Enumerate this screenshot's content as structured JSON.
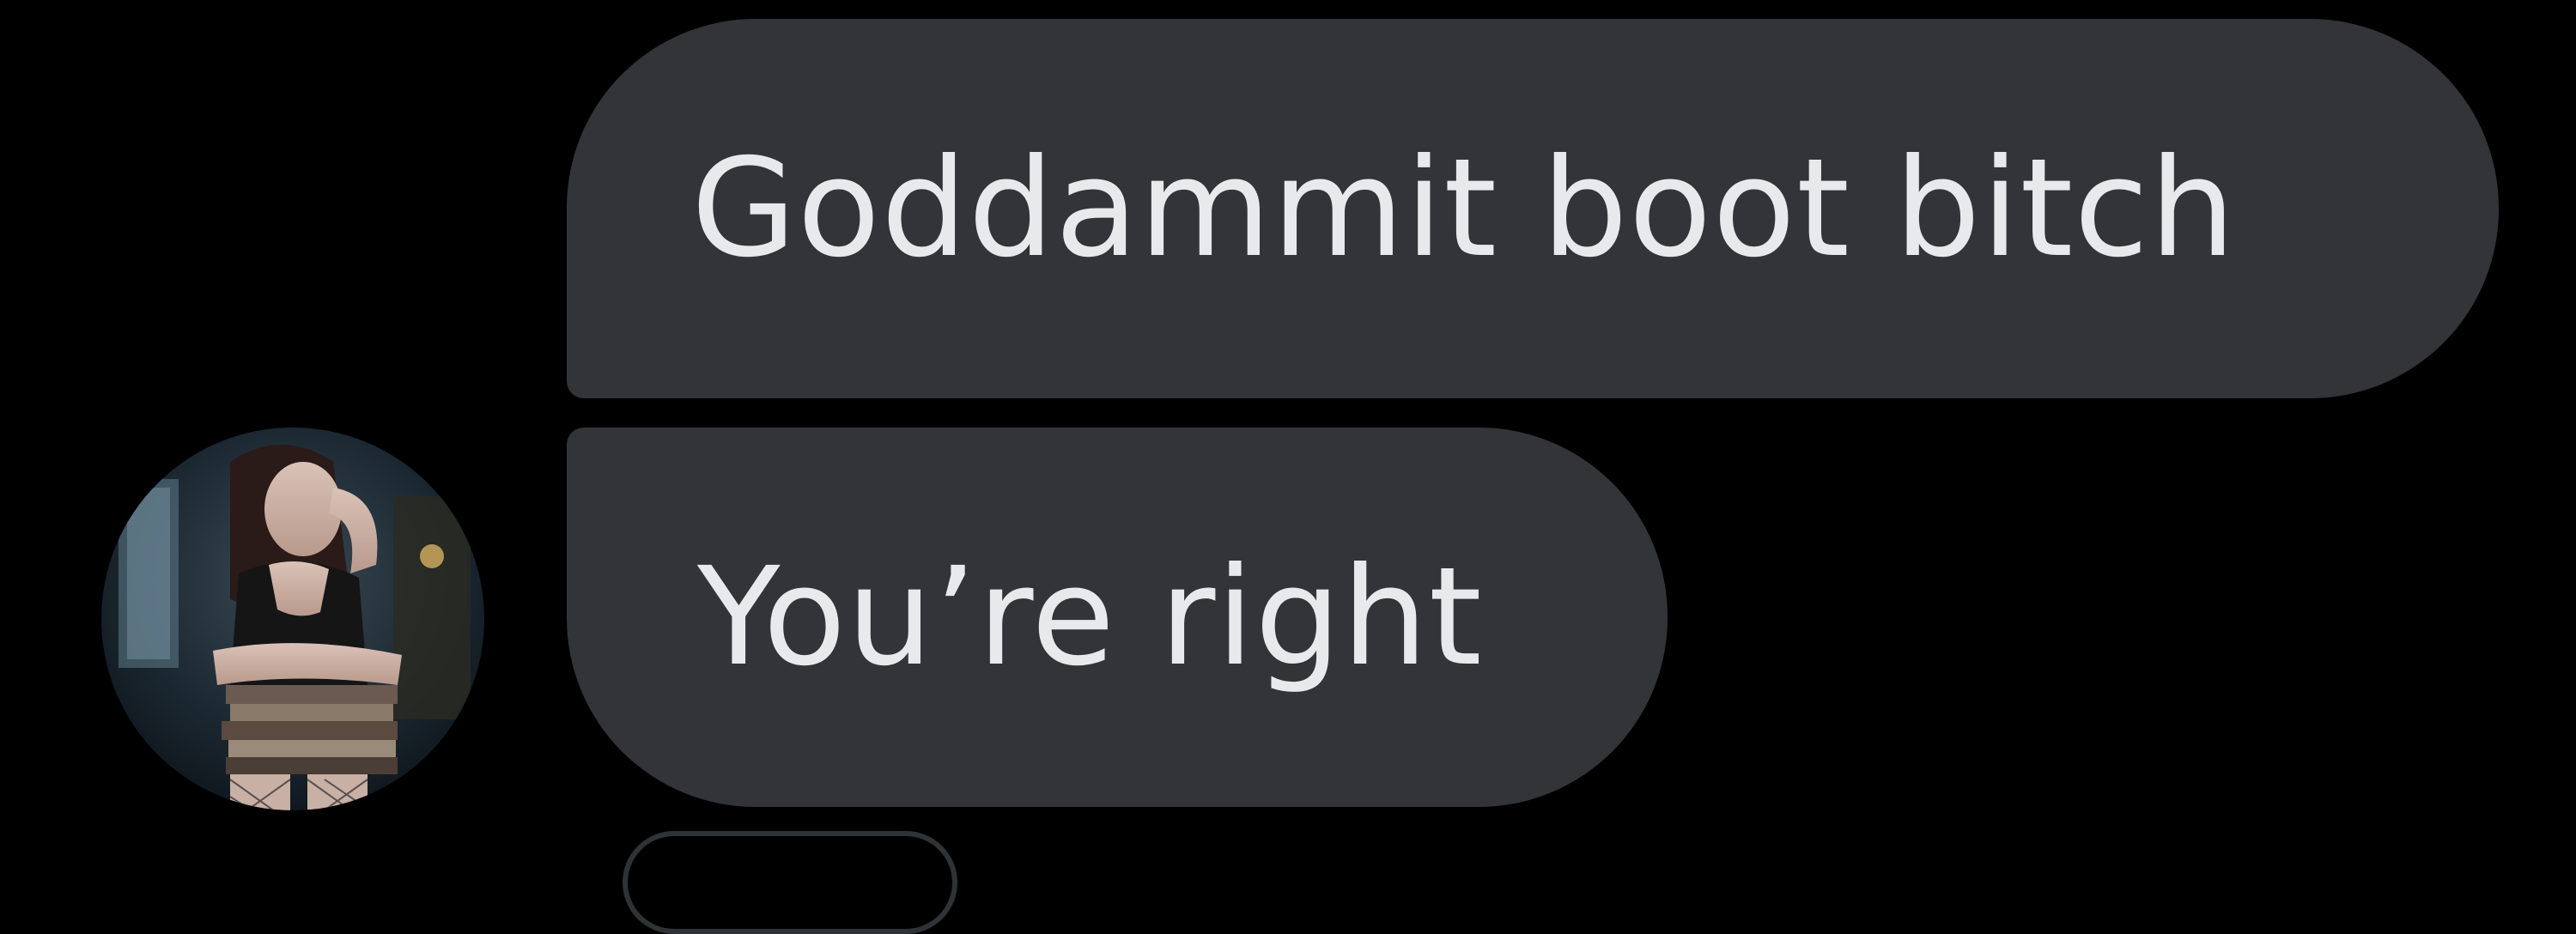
{
  "conversation": {
    "messages": [
      {
        "text": "Goddammit boot bitch"
      },
      {
        "text": "You’re right"
      }
    ],
    "sender": {
      "avatar_icon": "profile-photo-avatar-icon"
    }
  },
  "colors": {
    "background": "#000000",
    "bubble": "#323437",
    "text": "#e7e9ea"
  }
}
